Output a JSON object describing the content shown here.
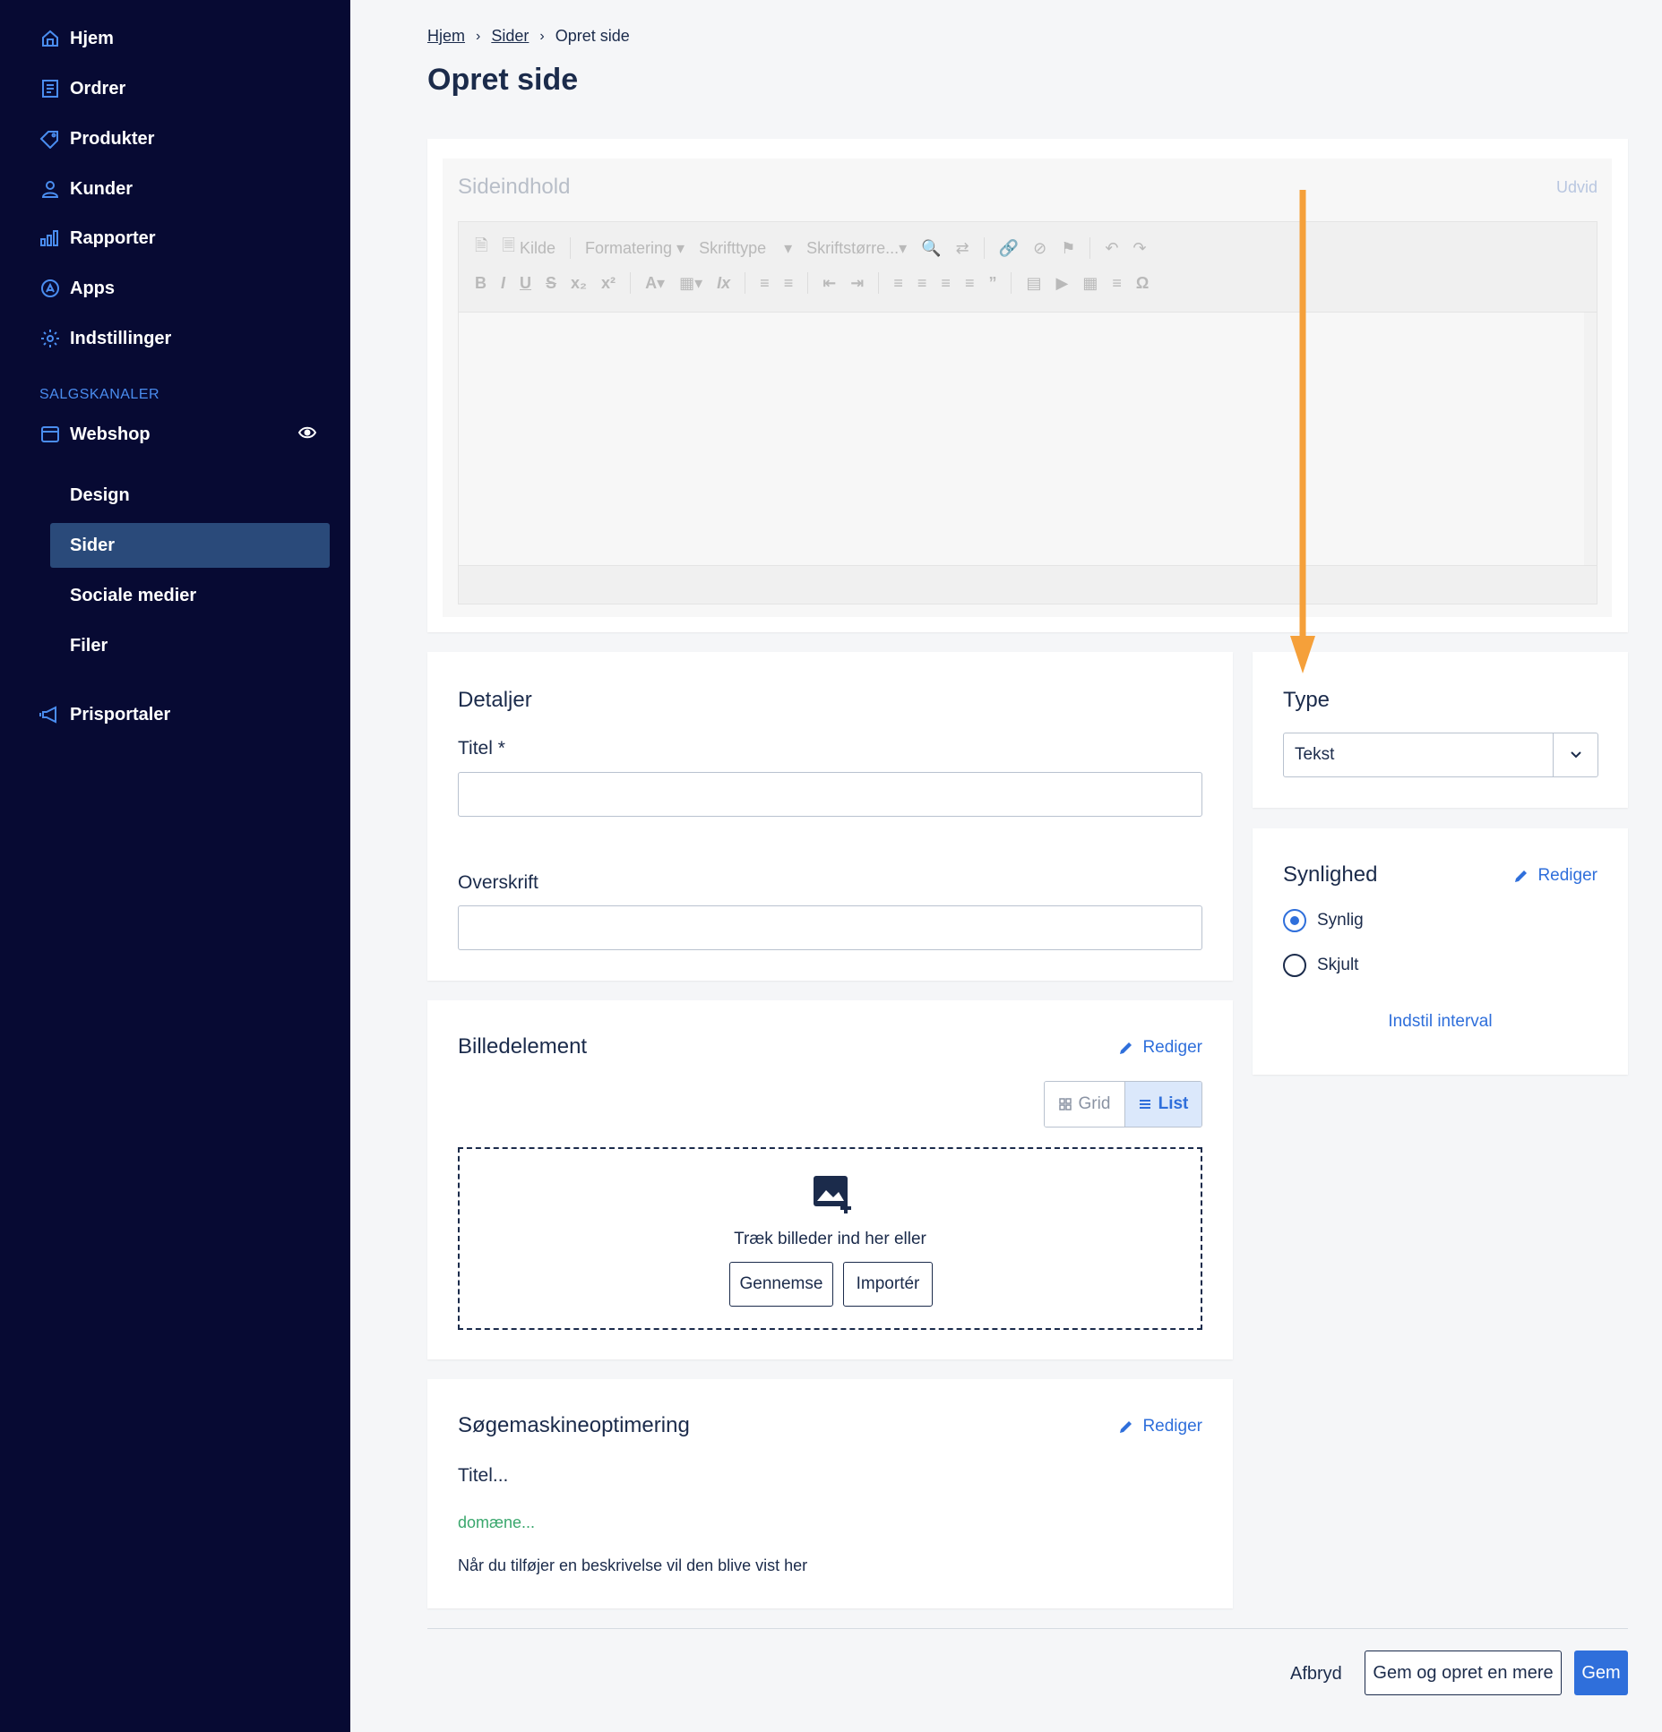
{
  "sidebar": {
    "items": [
      {
        "label": "Hjem",
        "icon": "home-icon"
      },
      {
        "label": "Ordrer",
        "icon": "orders-icon"
      },
      {
        "label": "Produkter",
        "icon": "tag-icon"
      },
      {
        "label": "Kunder",
        "icon": "user-icon"
      },
      {
        "label": "Rapporter",
        "icon": "chart-icon"
      },
      {
        "label": "Apps",
        "icon": "apps-icon"
      },
      {
        "label": "Indstillinger",
        "icon": "gear-icon"
      }
    ],
    "section_label": "SALGSKANALER",
    "webshop": {
      "label": "Webshop",
      "icon": "store-icon"
    },
    "sub_items": [
      "Design",
      "Sider",
      "Sociale medier",
      "Filer"
    ],
    "active_sub": "Sider",
    "prisportaler": {
      "label": "Prisportaler",
      "icon": "megaphone-icon"
    }
  },
  "breadcrumb": {
    "home": "Hjem",
    "pages": "Sider",
    "current": "Opret side"
  },
  "page_title": "Opret side",
  "editor": {
    "title": "Sideindhold",
    "expand": "Udvid",
    "source_label": "Kilde",
    "format_label": "Formatering",
    "font_label": "Skrifttype",
    "size_label": "Skriftstørre..."
  },
  "details": {
    "title": "Detaljer",
    "title_label": "Titel *",
    "title_value": "",
    "heading_label": "Overskrift",
    "heading_value": ""
  },
  "type": {
    "title": "Type",
    "selected": "Tekst"
  },
  "visibility": {
    "title": "Synlighed",
    "edit": "Rediger",
    "options": [
      "Synlig",
      "Skjult"
    ],
    "selected": "Synlig",
    "interval": "Indstil interval"
  },
  "image": {
    "title": "Billedelement",
    "edit": "Rediger",
    "grid": "Grid",
    "list": "List",
    "drop_text": "Træk billeder ind her eller",
    "browse": "Gennemse",
    "import": "Importér"
  },
  "seo": {
    "title": "Søgemaskineoptimering",
    "edit": "Rediger",
    "page_title": "Titel...",
    "domain": "domæne...",
    "description": "Når du tilføjer en beskrivelse vil den blive vist her"
  },
  "footer": {
    "cancel": "Afbryd",
    "save_more": "Gem og opret en mere",
    "save": "Gem"
  },
  "colors": {
    "sidebar_bg": "#070a33",
    "accent": "#2f6fdb",
    "active_bg": "#2a4a7a",
    "arrow": "#f5a03a",
    "seo_domain": "#3aa76d"
  }
}
